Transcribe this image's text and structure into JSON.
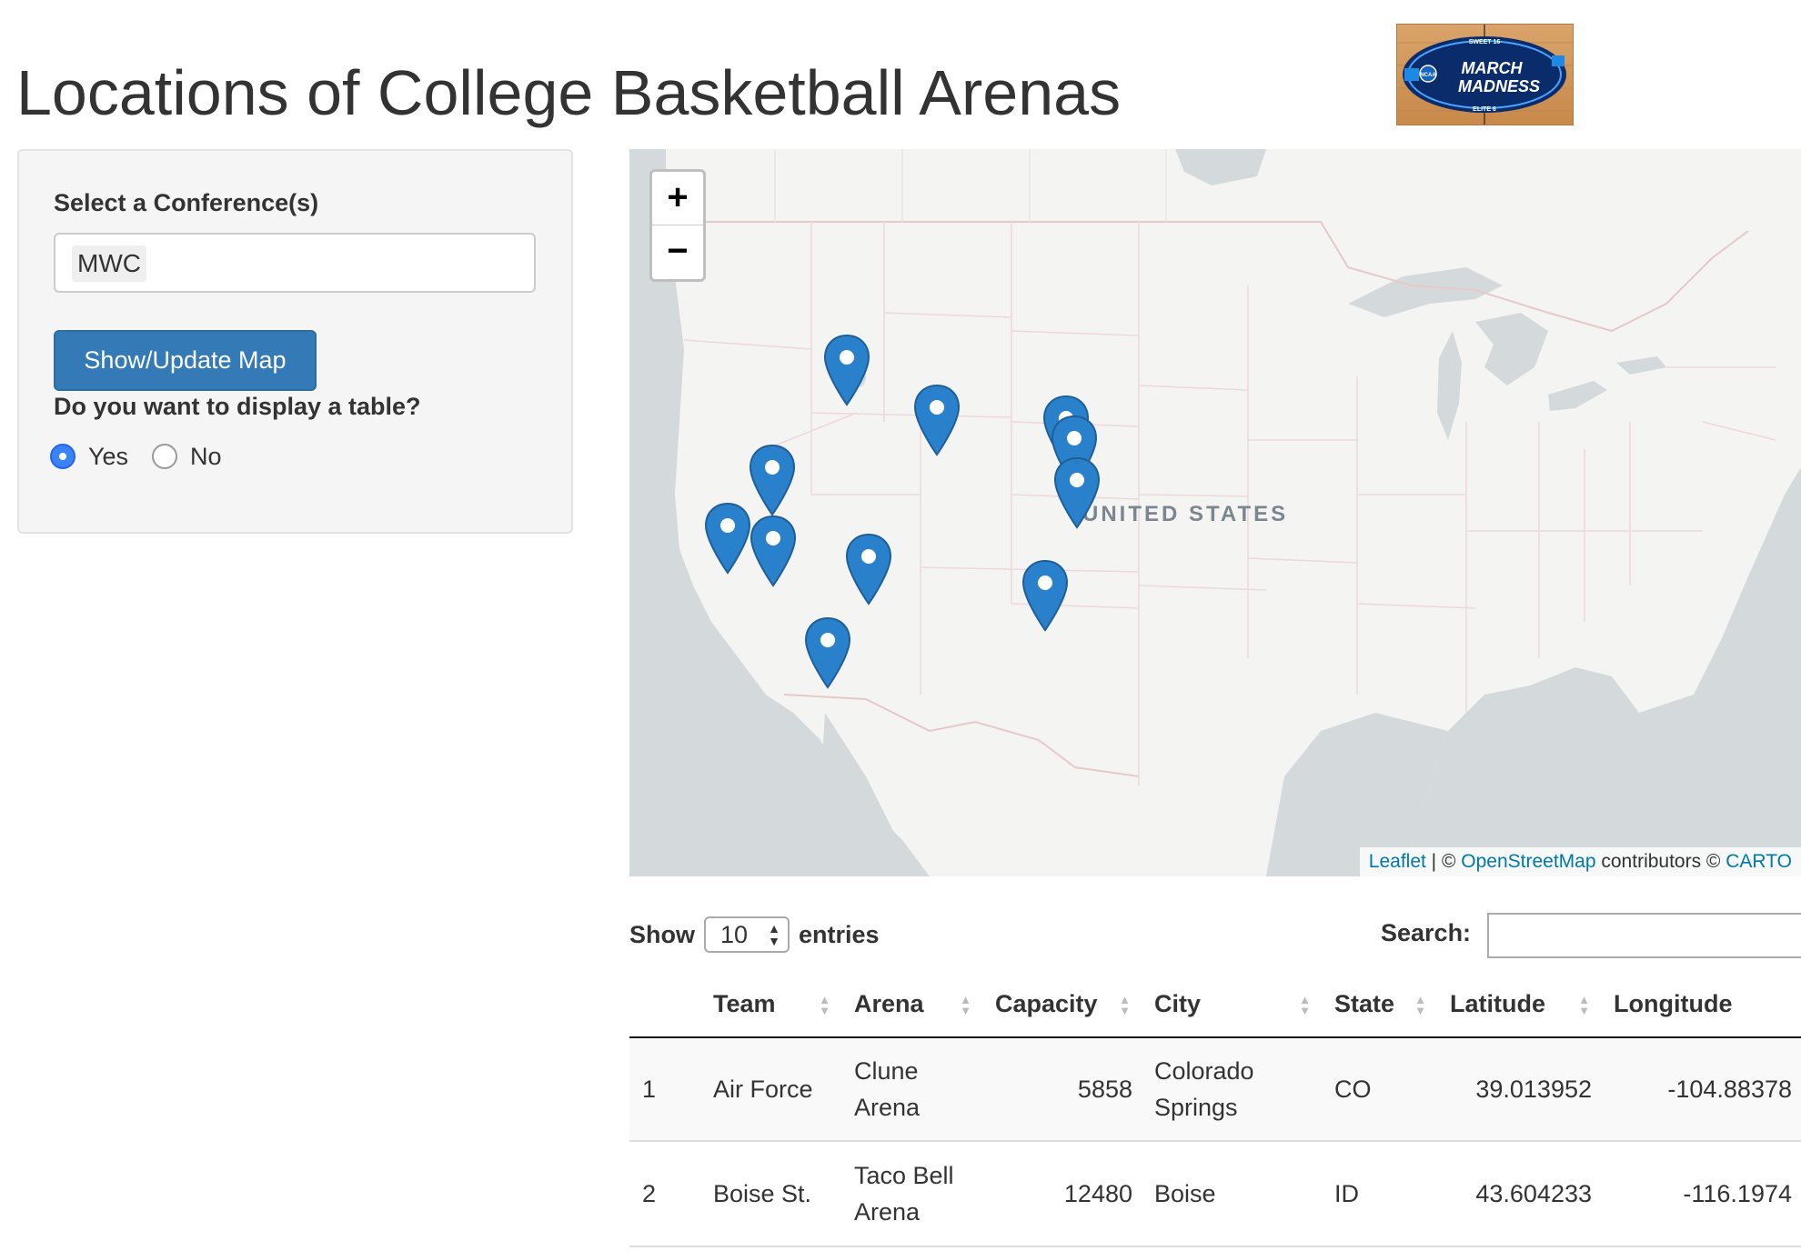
{
  "page": {
    "title": "Locations of College Basketball Arenas"
  },
  "logo": {
    "line1": "MARCH",
    "line2": "MADNESS",
    "top_text": "SWEET 16",
    "bottom_text": "ELITE 8",
    "badge": "NCAA"
  },
  "sidebar": {
    "conference_label": "Select a Conference(s)",
    "conference_selected": "MWC",
    "button_label": "Show/Update Map",
    "table_question": "Do you want to display a table?",
    "radio_yes": "Yes",
    "radio_no": "No",
    "radio_selected": "Yes"
  },
  "map": {
    "zoom_in": "+",
    "zoom_out": "−",
    "country_label": "UNITED STATES",
    "attribution_leaflet": "Leaflet",
    "attribution_sep": " | © ",
    "attribution_osm": "OpenStreetMap",
    "attribution_mid": " contributors © ",
    "attribution_carto": "CARTO",
    "marker_count": 12,
    "marker_color": "#2a81cb"
  },
  "table": {
    "show_label": "Show",
    "entries_value": "10",
    "entries_label": "entries",
    "search_label": "Search:",
    "columns": [
      "",
      "Team",
      "Arena",
      "Capacity",
      "City",
      "State",
      "Latitude",
      "Longitude"
    ],
    "rows": [
      {
        "index": "1",
        "team": "Air Force",
        "arena": "Clune Arena",
        "capacity": "5858",
        "city": "Colorado Springs",
        "state": "CO",
        "latitude": "39.013952",
        "longitude": "-104.88378"
      },
      {
        "index": "2",
        "team": "Boise St.",
        "arena": "Taco Bell Arena",
        "capacity": "12480",
        "city": "Boise",
        "state": "ID",
        "latitude": "43.604233",
        "longitude": "-116.1974"
      }
    ]
  }
}
